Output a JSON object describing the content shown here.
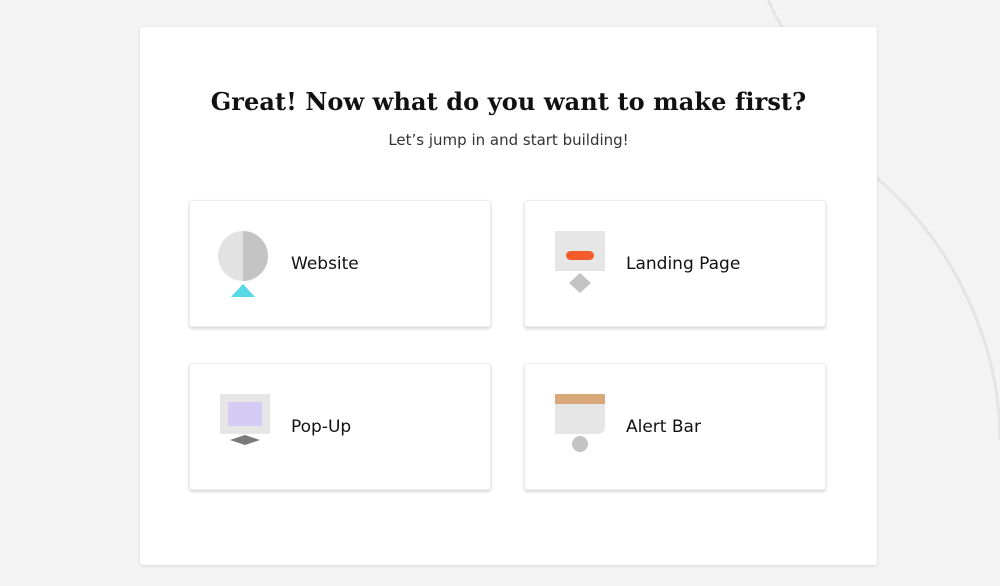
{
  "heading": {
    "title": "Great! Now what do you want to make first?",
    "subtitle": "Let’s jump in and start building!"
  },
  "options": [
    {
      "label": "Website",
      "icon": "website-icon"
    },
    {
      "label": "Landing Page",
      "icon": "landing-page-icon"
    },
    {
      "label": "Pop-Up",
      "icon": "popup-icon"
    },
    {
      "label": "Alert Bar",
      "icon": "alert-bar-icon"
    }
  ],
  "colors": {
    "background": "#f3f3f3",
    "card": "#ffffff",
    "website_accent": "#56d8e6",
    "landing_accent": "#f25c2b",
    "popup_accent": "#d4ccf5",
    "alert_accent": "#d8a77a",
    "icon_gray": "#e2e2e2",
    "icon_dark_gray": "#c4c4c4"
  }
}
